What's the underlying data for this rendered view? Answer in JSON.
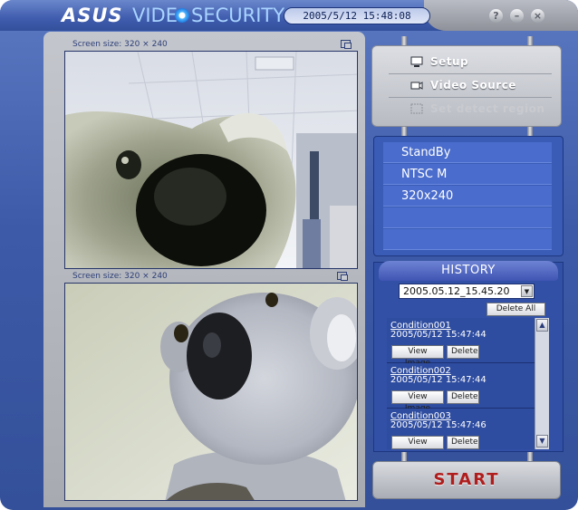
{
  "app": {
    "logo_brand": "ASUS",
    "logo_product_a": "VIDE",
    "logo_product_b": "SECURITY",
    "datetime": "2005/5/12   15:48:08",
    "window_buttons": {
      "help": "?",
      "minimize": "–",
      "close": "×"
    }
  },
  "video": {
    "top": {
      "screen_size_label": "Screen size: 320 × 240"
    },
    "bottom": {
      "screen_size_label": "Screen size: 320 × 240"
    }
  },
  "menu": {
    "items": [
      {
        "label": "Setup",
        "icon": "monitor-icon",
        "enabled": true
      },
      {
        "label": "Video Source",
        "icon": "camera-icon",
        "enabled": true
      },
      {
        "label": "Set detect region",
        "icon": "region-icon",
        "enabled": false
      }
    ]
  },
  "status": {
    "rows": [
      "StandBy",
      "NTSC M",
      "320x240",
      "",
      ""
    ]
  },
  "history": {
    "title": "HISTORY",
    "selected_date": "2005.05.12_15.45.20",
    "delete_all_label": "Delete All",
    "view_label": "View Image",
    "delete_label": "Delete",
    "items": [
      {
        "name": "Condition001",
        "time": "2005/05/12 15:47:44"
      },
      {
        "name": "Condition002",
        "time": "2005/05/12 15:47:44"
      },
      {
        "name": "Condition003",
        "time": "2005/05/12 15:47:46"
      }
    ]
  },
  "start_label": "START",
  "colors": {
    "frame_blue": "#3c5aa8",
    "panel_blue": "#3a5cb6",
    "start_red": "#b01d1d",
    "datetime_bg": "#dfe6f7"
  }
}
